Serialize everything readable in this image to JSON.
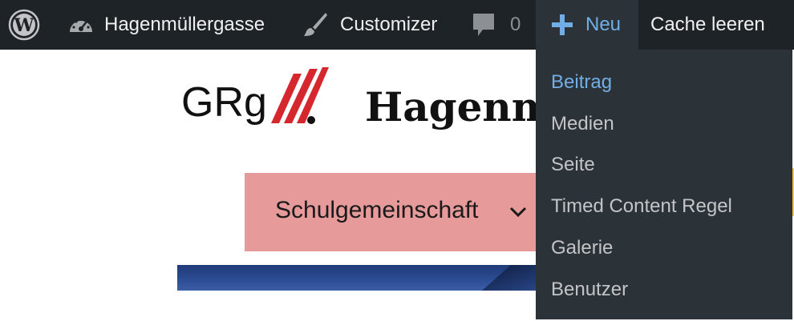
{
  "admin_bar": {
    "site_name": "Hagenmüllergasse",
    "customizer": "Customizer",
    "comments_count": "0",
    "new_label": "Neu",
    "cache_label": "Cache leeren"
  },
  "new_menu": {
    "items": [
      "Beitrag",
      "Medien",
      "Seite",
      "Timed Content Regel",
      "Galerie",
      "Benutzer"
    ]
  },
  "site": {
    "logo_text": "GRg",
    "title": "Hagenm",
    "nav_item": "Schulgemeinschaft"
  },
  "colors": {
    "admin_bar_bg": "#1d2327",
    "submenu_bg": "#2c3338",
    "accent_blue": "#72aee6",
    "nav_bg": "#e69a9a",
    "logo_red": "#d6272f"
  }
}
